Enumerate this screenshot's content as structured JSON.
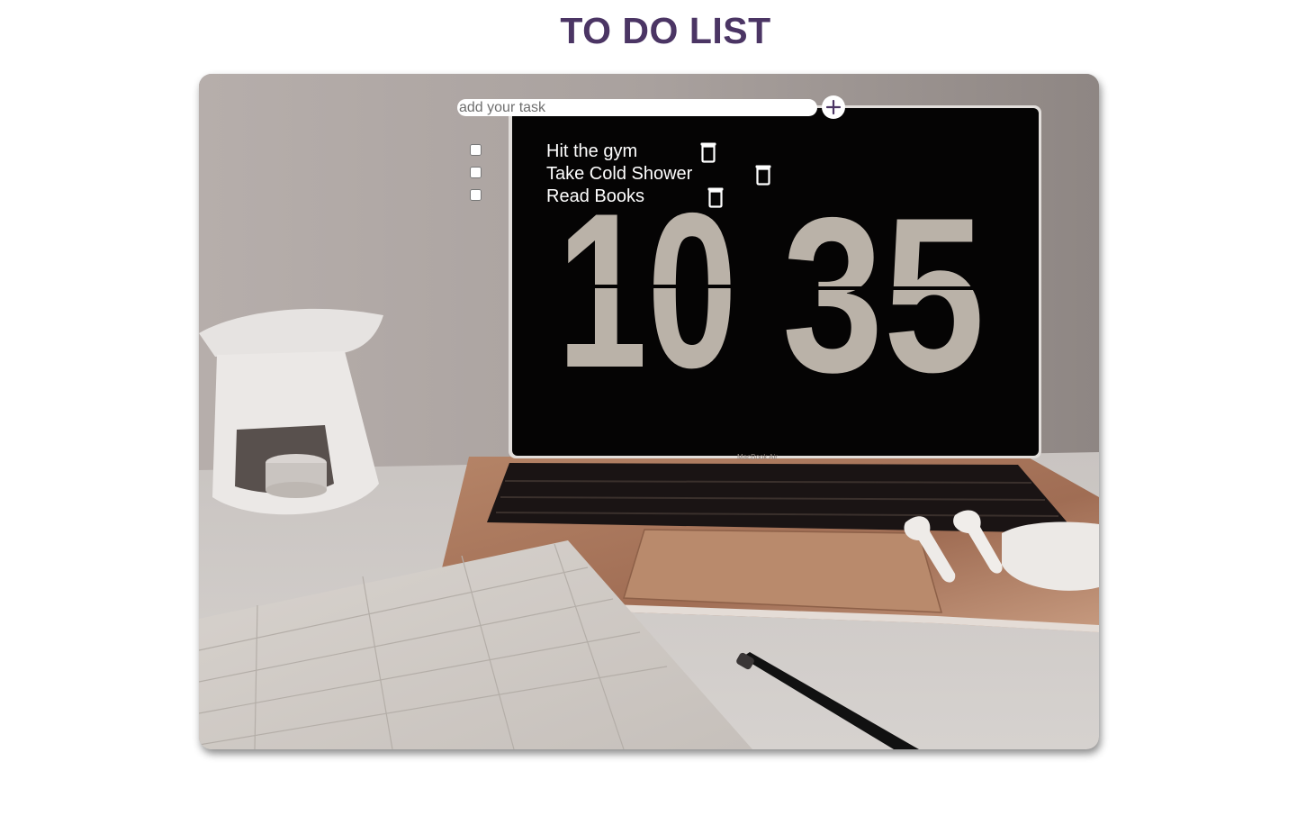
{
  "title": "TO DO LIST",
  "colors": {
    "title": "#4b3564",
    "accent": "#4b3564",
    "task_text": "#ffffff"
  },
  "input": {
    "placeholder": "add your task",
    "value": ""
  },
  "add_button": {
    "icon": "plus-icon"
  },
  "tasks": [
    {
      "text": "Hit the gym",
      "checked": false,
      "delete_icon": "trash-icon"
    },
    {
      "text": "Take Cold Shower",
      "checked": false,
      "delete_icon": "trash-icon"
    },
    {
      "text": "Read Books",
      "checked": false,
      "delete_icon": "trash-icon"
    }
  ],
  "clock": {
    "hours": "10",
    "minutes": "35"
  }
}
